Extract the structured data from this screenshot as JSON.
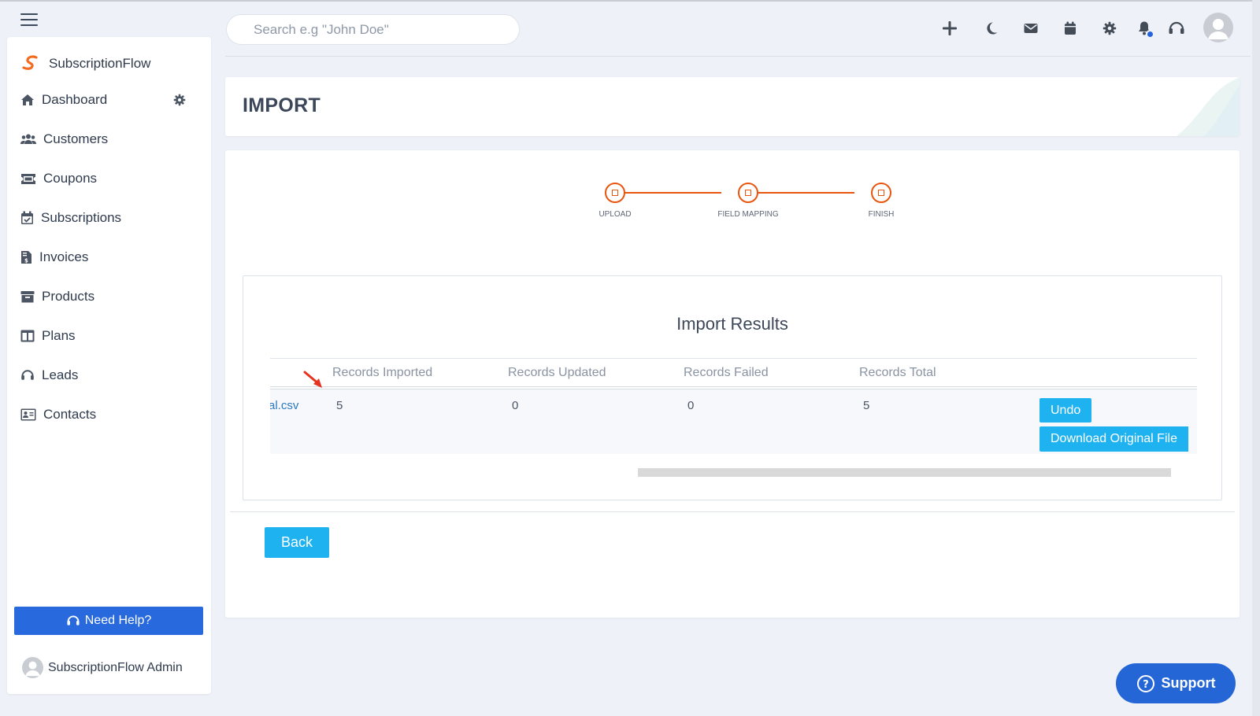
{
  "topbar": {
    "search_placeholder": "Search e.g \"John Doe\"",
    "icons": [
      "plus-icon",
      "moon-icon",
      "mail-icon",
      "calendar-icon",
      "gear-icon",
      "bell-icon",
      "headset-icon",
      "avatar"
    ]
  },
  "sidebar": {
    "brand": "SubscriptionFlow",
    "items": [
      {
        "label": "Dashboard",
        "icon": "home-icon"
      },
      {
        "label": "Customers",
        "icon": "users-icon"
      },
      {
        "label": "Coupons",
        "icon": "ticket-icon"
      },
      {
        "label": "Subscriptions",
        "icon": "calendar-check-icon"
      },
      {
        "label": "Invoices",
        "icon": "invoice-icon"
      },
      {
        "label": "Products",
        "icon": "archive-icon"
      },
      {
        "label": "Plans",
        "icon": "columns-icon"
      },
      {
        "label": "Leads",
        "icon": "headset-icon"
      },
      {
        "label": "Contacts",
        "icon": "address-card-icon"
      }
    ],
    "need_help": "Need Help?",
    "admin_name": "SubscriptionFlow Admin"
  },
  "page": {
    "title": "IMPORT"
  },
  "steps": [
    "UPLOAD",
    "FIELD MAPPING",
    "FINISH"
  ],
  "results": {
    "title": "Import Results",
    "columns": [
      "Records Imported",
      "Records Updated",
      "Records Failed",
      "Records Total"
    ],
    "row": {
      "file": "al.csv",
      "imported": "5",
      "updated": "0",
      "failed": "0",
      "total": "5"
    },
    "undo_label": "Undo",
    "download_label": "Download Original File"
  },
  "back_label": "Back",
  "support_label": "Support",
  "colors": {
    "accent": "#1fb2f0",
    "stepper": "#e8550e",
    "primary_blue": "#2466d6"
  }
}
